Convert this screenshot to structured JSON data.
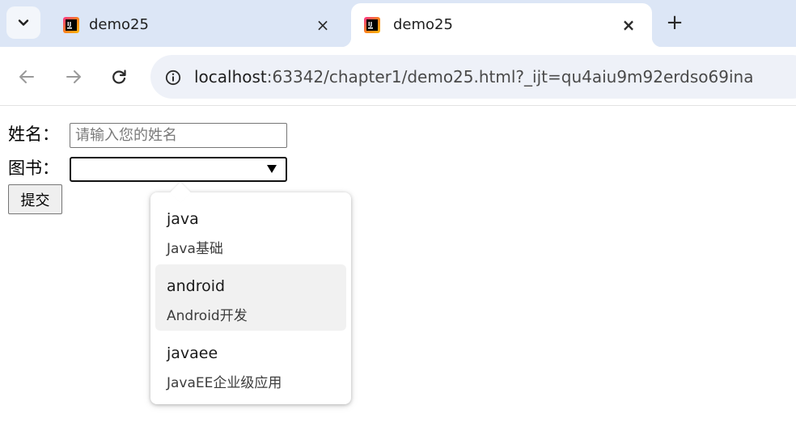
{
  "browser": {
    "tabs": [
      {
        "title": "demo25",
        "active": false
      },
      {
        "title": "demo25",
        "active": true
      }
    ],
    "tab_close_glyph": "×",
    "new_tab_glyph": "+",
    "address": {
      "host": "localhost",
      "path": ":63342/chapter1/demo25.html?_ijt=qu4aiu9m92erdso69ina"
    },
    "accent_color": "#dce6f6"
  },
  "form": {
    "name_label": "姓名：",
    "name_placeholder": "请输入您的姓名",
    "name_value": "",
    "book_label": "图书：",
    "book_value": "",
    "submit_label": "提交"
  },
  "datalist": {
    "options": [
      {
        "value": "java",
        "label": "Java基础",
        "highlighted": false
      },
      {
        "value": "android",
        "label": "Android开发",
        "highlighted": true
      },
      {
        "value": "javaee",
        "label": "JavaEE企业级应用",
        "highlighted": false
      }
    ]
  },
  "icons": {
    "tab_menu": "chevron-down-icon",
    "favicon": "jetbrains-icon",
    "back": "arrow-left-icon",
    "forward": "arrow-right-icon",
    "reload": "reload-icon",
    "site_info": "info-icon",
    "select_arrow": "triangle-down-icon"
  }
}
